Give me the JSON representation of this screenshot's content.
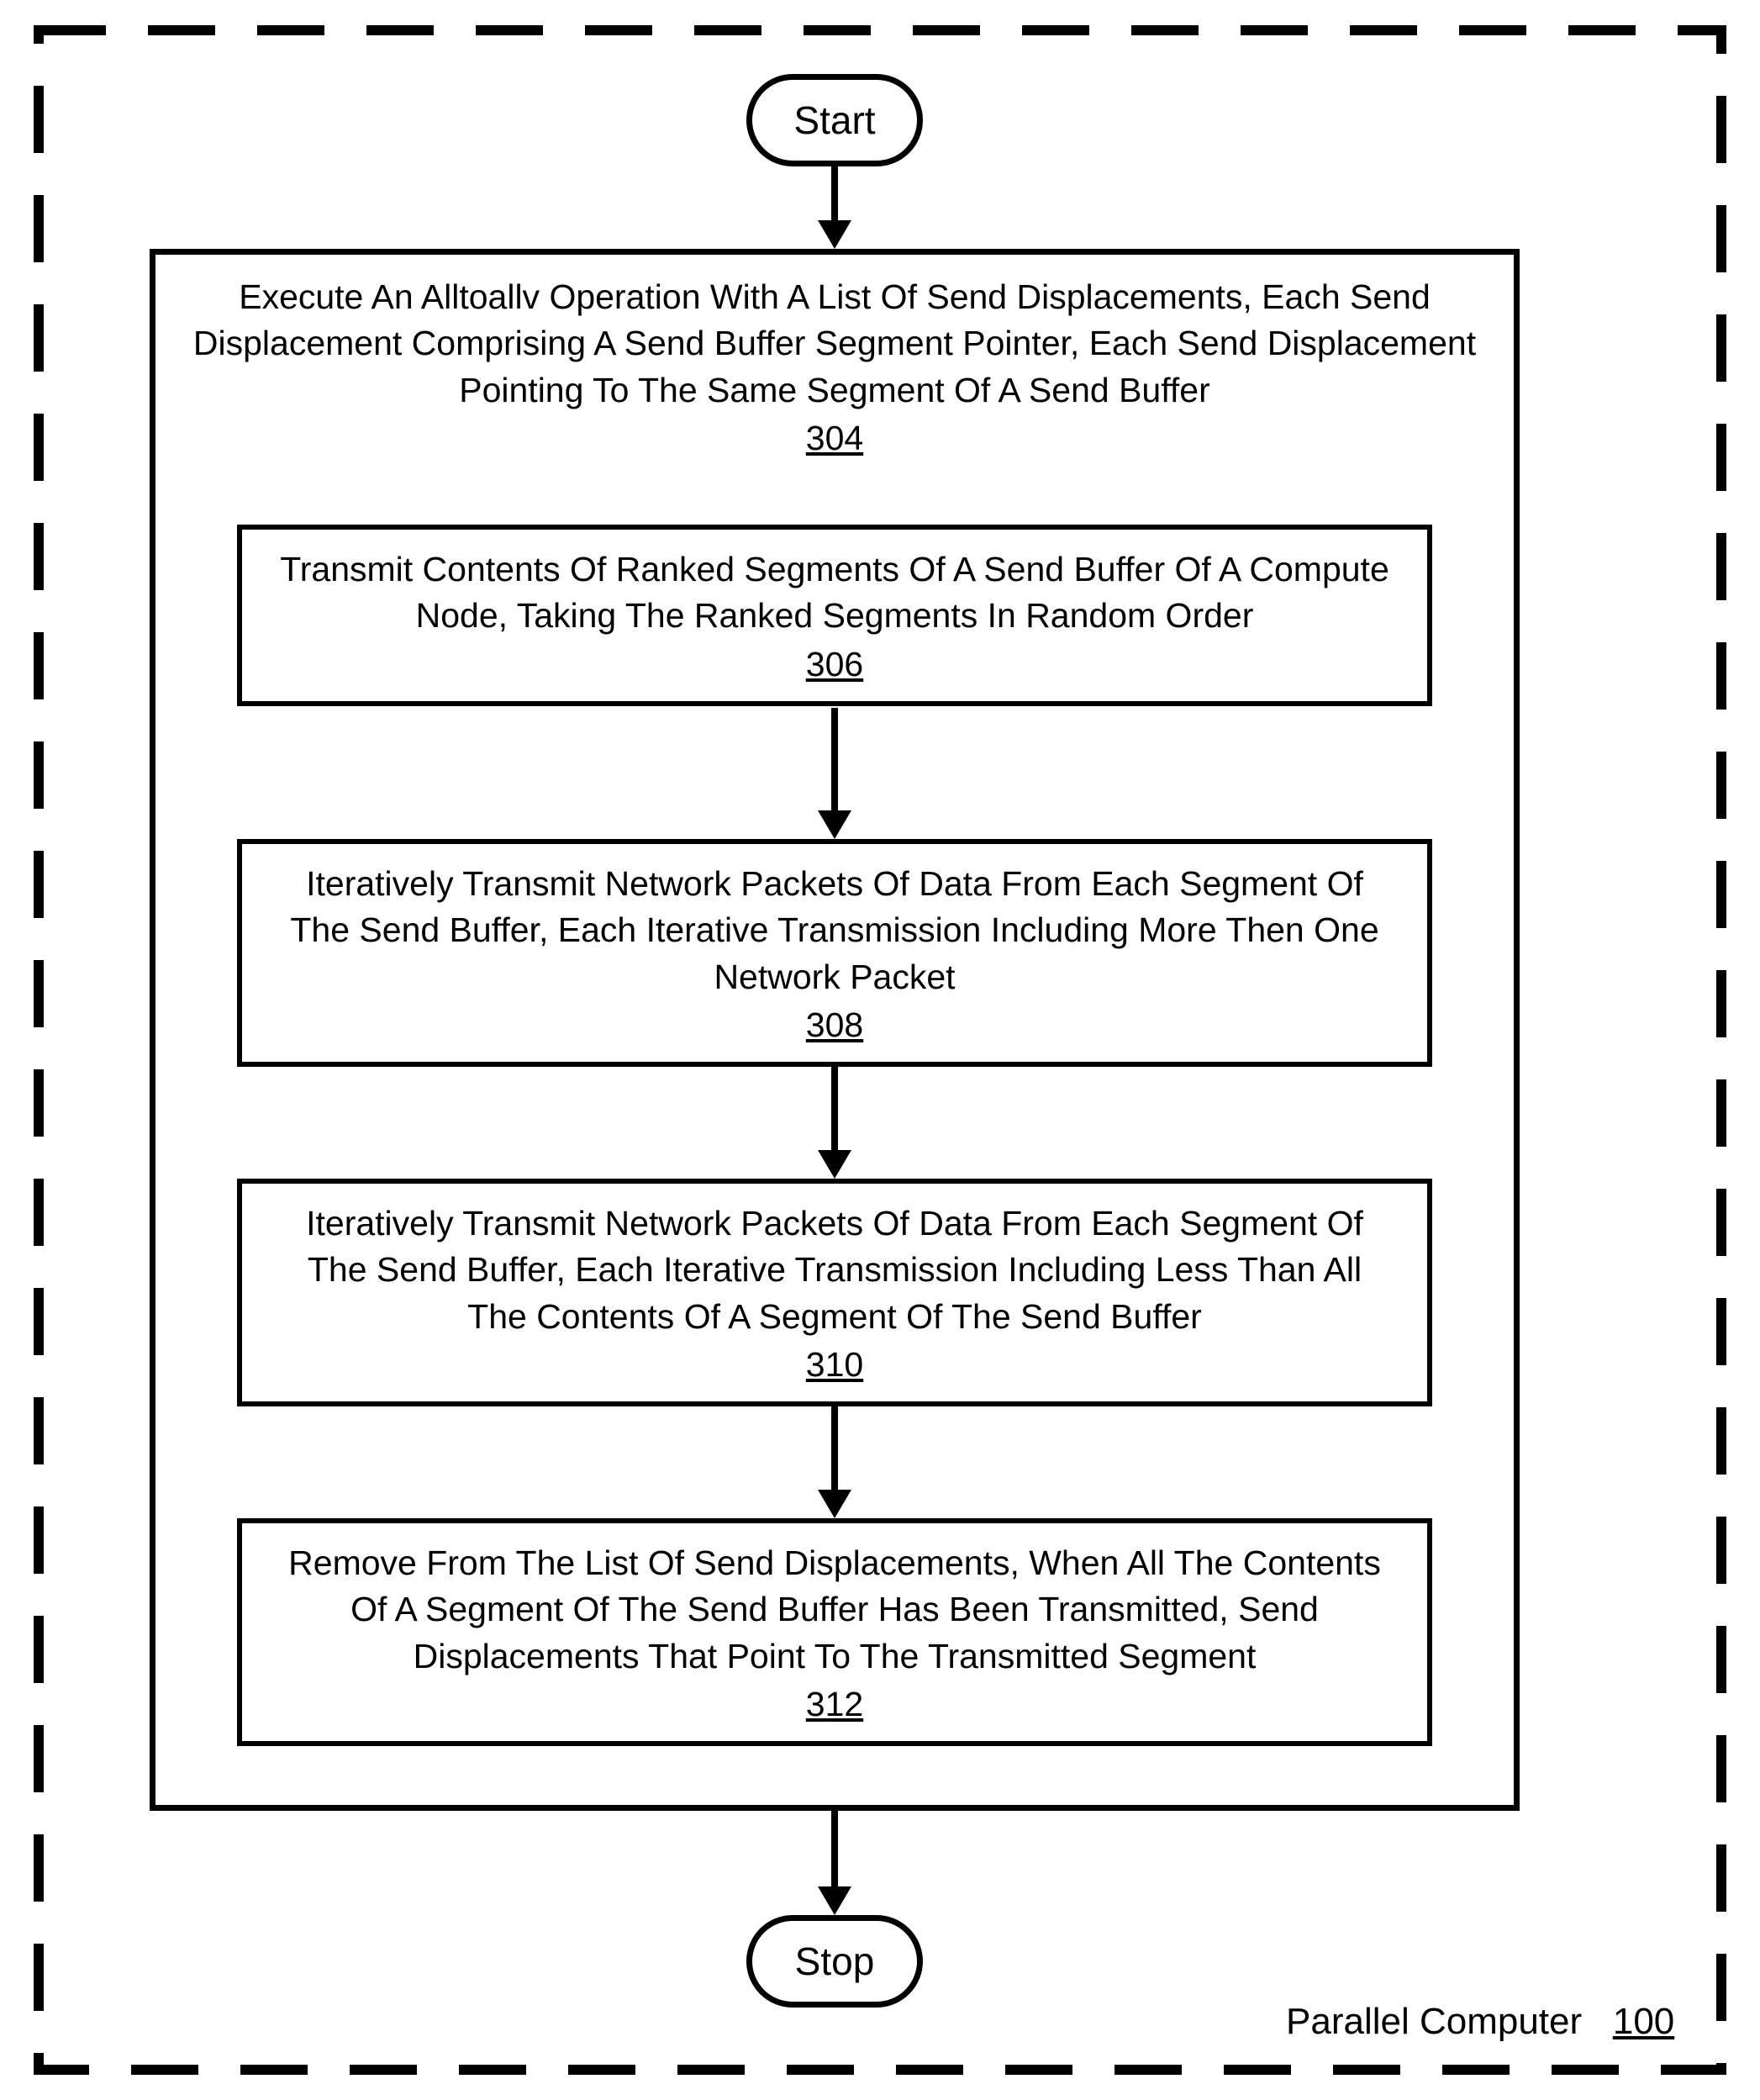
{
  "terminators": {
    "start": "Start",
    "stop": "Stop"
  },
  "outer_box_ref": "304",
  "steps": {
    "s304": {
      "text": "Execute An Alltoallv Operation With A List Of Send Displacements, Each Send Displacement Comprising A Send Buffer Segment Pointer, Each Send Displacement Pointing To The Same Segment Of A Send Buffer",
      "ref": "304"
    },
    "s306": {
      "text": "Transmit Contents Of Ranked Segments Of A Send Buffer Of A Compute Node, Taking The Ranked Segments In Random Order",
      "ref": "306"
    },
    "s308": {
      "text": "Iteratively Transmit Network Packets Of Data From Each Segment Of The Send Buffer, Each Iterative Transmission Including More Then One Network Packet",
      "ref": "308"
    },
    "s310": {
      "text": "Iteratively Transmit Network Packets Of Data From Each Segment Of The Send Buffer, Each Iterative Transmission Including Less Than All The Contents Of A Segment Of The Send Buffer",
      "ref": "310"
    },
    "s312": {
      "text": "Remove From The List Of Send Displacements, When All The Contents Of A Segment Of The Send Buffer Has Been Transmitted, Send Displacements That Point To The Transmitted Segment",
      "ref": "312"
    }
  },
  "footer": {
    "label": "Parallel Computer",
    "ref": "100"
  }
}
